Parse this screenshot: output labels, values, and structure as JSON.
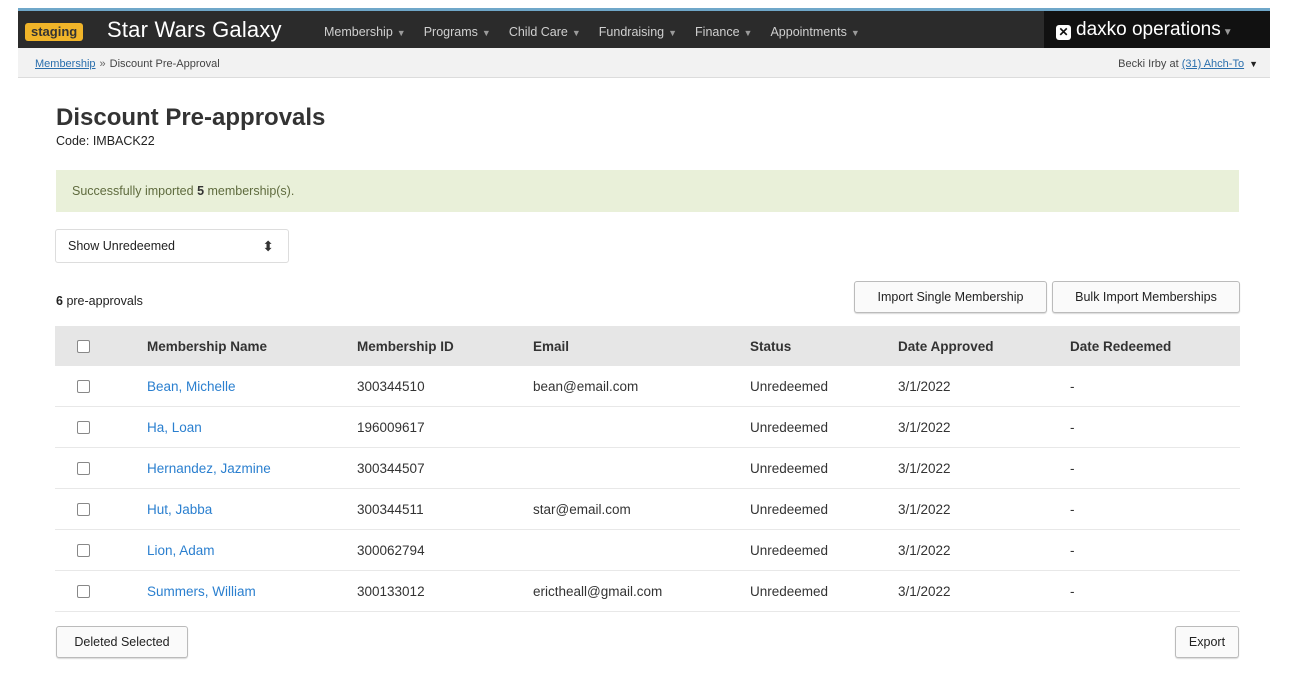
{
  "nav": {
    "env_badge": "staging",
    "brand": "Star Wars Galaxy",
    "menu": [
      {
        "label": "Membership"
      },
      {
        "label": "Programs"
      },
      {
        "label": "Child Care"
      },
      {
        "label": "Fundraising"
      },
      {
        "label": "Finance"
      },
      {
        "label": "Appointments"
      }
    ],
    "product": "daxko operations"
  },
  "breadcrumb": {
    "root": "Membership",
    "separator": "»",
    "current": "Discount Pre-Approval"
  },
  "user": {
    "name": "Becki Irby at",
    "location": "(31) Ahch-To"
  },
  "page": {
    "title": "Discount Pre-approvals",
    "code": "Code: IMBACK22"
  },
  "alert": {
    "prefix": "Successfully imported",
    "count": "5",
    "suffix": "membership(s)."
  },
  "filter": {
    "selected": "Show Unredeemed"
  },
  "summary": {
    "count": "6",
    "label": "pre-approvals"
  },
  "buttons": {
    "import_single": "Import Single Membership",
    "bulk_import": "Bulk Import Memberships",
    "delete_selected": "Deleted Selected",
    "export": "Export"
  },
  "table": {
    "headers": [
      "Membership Name",
      "Membership ID",
      "Email",
      "Status",
      "Date Approved",
      "Date Redeemed"
    ],
    "rows": [
      {
        "name": "Bean, Michelle",
        "id": "300344510",
        "email": "bean@email.com",
        "status": "Unredeemed",
        "approved": "3/1/2022",
        "redeemed": "-"
      },
      {
        "name": "Ha, Loan",
        "id": "196009617",
        "email": "",
        "status": "Unredeemed",
        "approved": "3/1/2022",
        "redeemed": "-"
      },
      {
        "name": "Hernandez, Jazmine",
        "id": "300344507",
        "email": "",
        "status": "Unredeemed",
        "approved": "3/1/2022",
        "redeemed": "-"
      },
      {
        "name": "Hut, Jabba",
        "id": "300344511",
        "email": "star@email.com",
        "status": "Unredeemed",
        "approved": "3/1/2022",
        "redeemed": "-"
      },
      {
        "name": "Lion, Adam",
        "id": "300062794",
        "email": "",
        "status": "Unredeemed",
        "approved": "3/1/2022",
        "redeemed": "-"
      },
      {
        "name": "Summers, William",
        "id": "300133012",
        "email": "erictheall@gmail.com",
        "status": "Unredeemed",
        "approved": "3/1/2022",
        "redeemed": "-"
      }
    ]
  },
  "colors": {
    "nav_bg": "#2b2b2b",
    "badge": "#f0b429",
    "link": "#2a7fcf",
    "alert_bg": "#e9f0d9"
  }
}
